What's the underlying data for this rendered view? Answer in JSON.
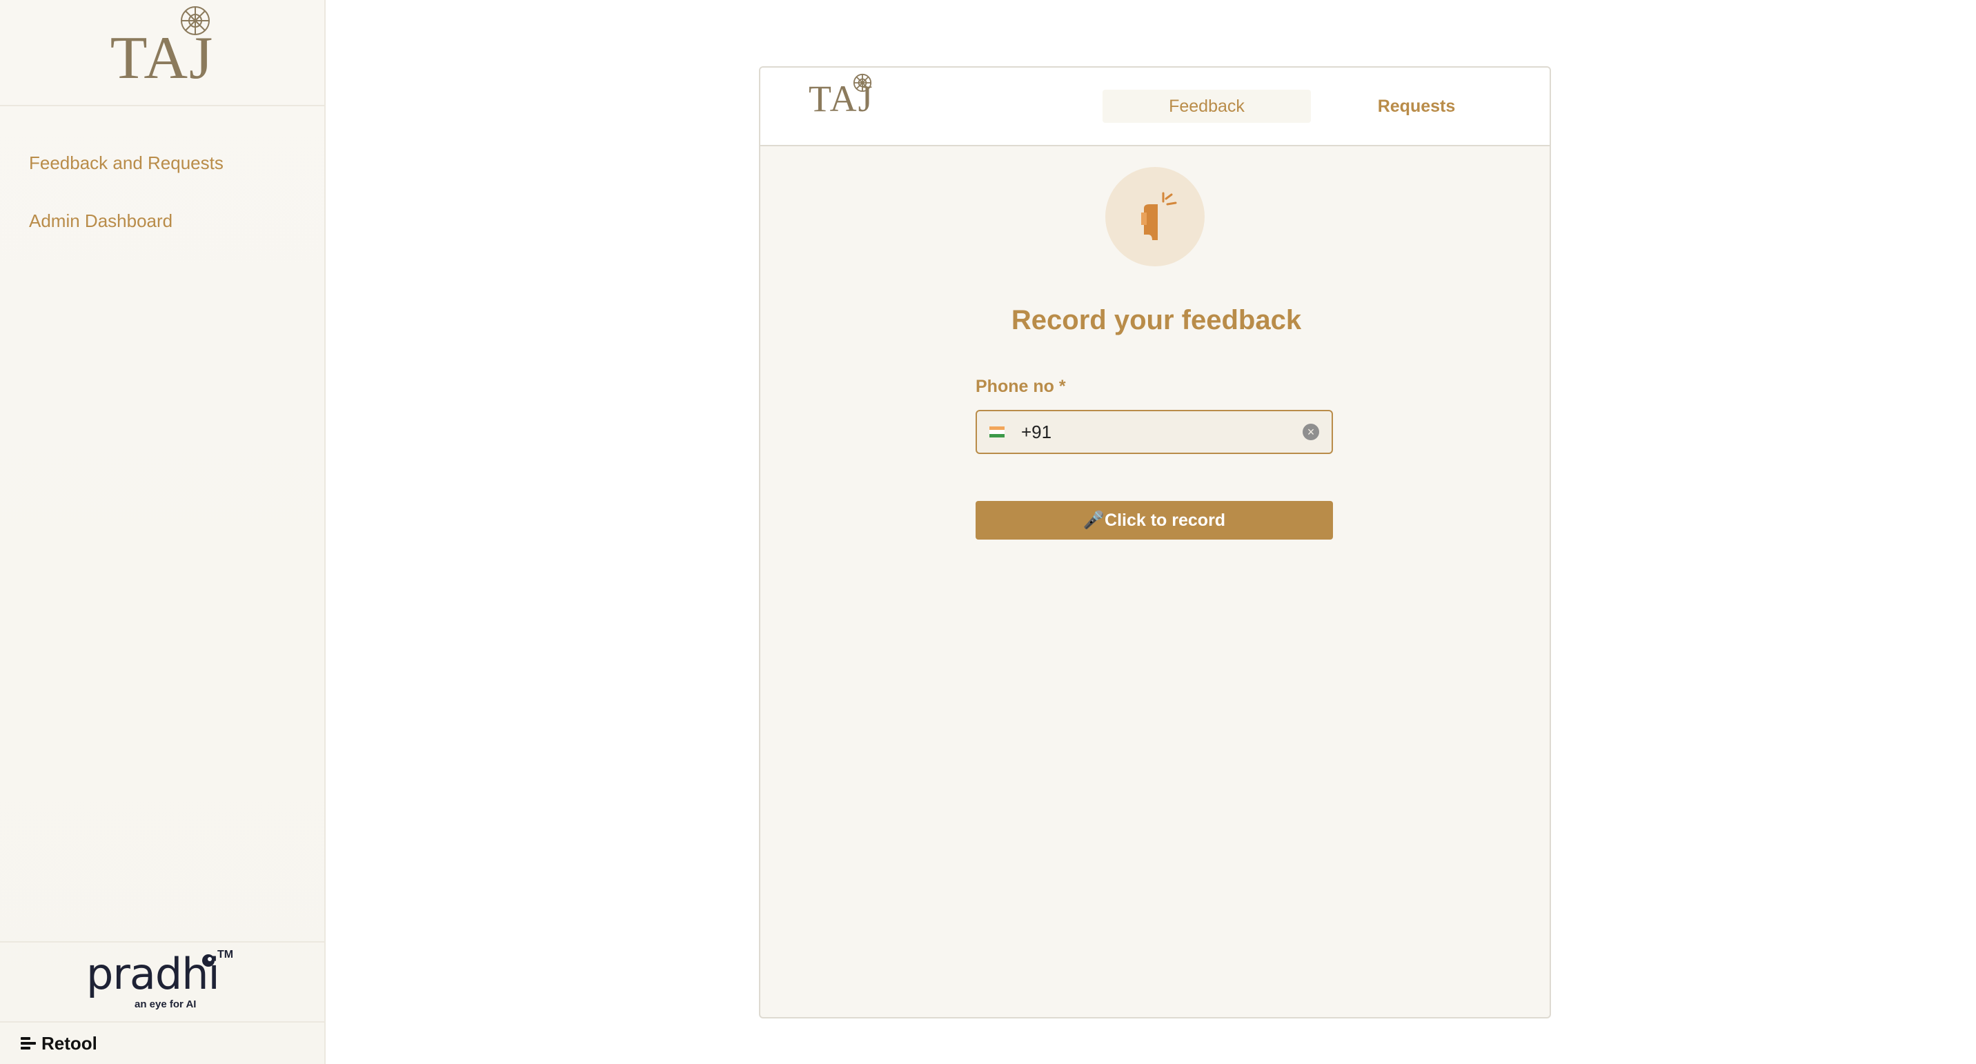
{
  "sidebar": {
    "logo_text": "TAJ",
    "nav": [
      {
        "label": "Feedback and Requests"
      },
      {
        "label": "Admin Dashboard"
      }
    ],
    "footer_logo_text": "pradhi",
    "footer_logo_tagline": "an eye for AI",
    "footer_logo_tm": "TM",
    "retool_label": "Retool"
  },
  "card": {
    "logo_text": "TAJ",
    "tabs": [
      {
        "label": "Feedback",
        "selected": true
      },
      {
        "label": "Requests",
        "selected": false
      }
    ],
    "title": "Record your feedback",
    "phone": {
      "label": "Phone no",
      "required_mark": "*",
      "value": "+91",
      "country_icon": "india-flag-icon"
    },
    "record_button": "🎤Click to record"
  },
  "colors": {
    "accent": "#b98c49",
    "logo": "#8b7a5c",
    "background": "#f8f6f1"
  }
}
